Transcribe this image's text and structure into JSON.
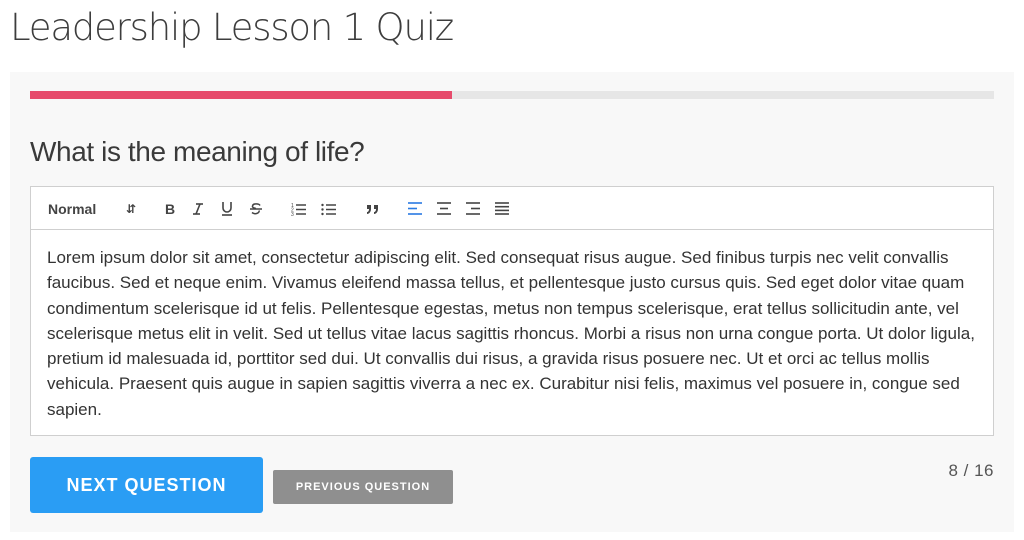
{
  "page": {
    "title": "Leadership Lesson 1 Quiz"
  },
  "progress": {
    "fraction": 0.438,
    "color": "#e64a6b"
  },
  "question": {
    "text": "What is the meaning of life?"
  },
  "editor": {
    "toolbar": {
      "format_value": "Normal",
      "icons": [
        "bold-icon",
        "italic-icon",
        "underline-icon",
        "strikethrough-icon",
        "ordered-list-icon",
        "bullet-list-icon",
        "blockquote-icon",
        "align-left-icon",
        "align-center-icon",
        "align-right-icon",
        "align-justify-icon"
      ],
      "active_color": "#2a7ae2"
    },
    "content": "Lorem ipsum dolor sit amet, consectetur adipiscing elit. Sed consequat risus augue. Sed finibus turpis nec velit convallis faucibus. Sed et neque enim. Vivamus eleifend massa tellus, et pellentesque justo cursus quis. Sed eget dolor vitae quam condimentum scelerisque id ut felis. Pellentesque egestas, metus non tempus scelerisque, erat tellus sollicitudin ante, vel scelerisque metus elit in velit. Sed ut tellus vitae lacus sagittis rhoncus. Morbi a risus non urna congue porta. Ut dolor ligula, pretium id malesuada id, porttitor sed dui. Ut convallis dui risus, a gravida risus posuere nec. Ut et orci ac tellus mollis vehicula. Praesent quis augue in sapien sagittis viverra a nec ex. Curabitur nisi felis, maximus vel posuere in, congue sed sapien."
  },
  "navigation": {
    "next_label": "NEXT QUESTION",
    "prev_label": "PREVIOUS QUESTION",
    "counter": "8 / 16",
    "next_color": "#2a9df4",
    "prev_color": "#8f8f8f"
  }
}
